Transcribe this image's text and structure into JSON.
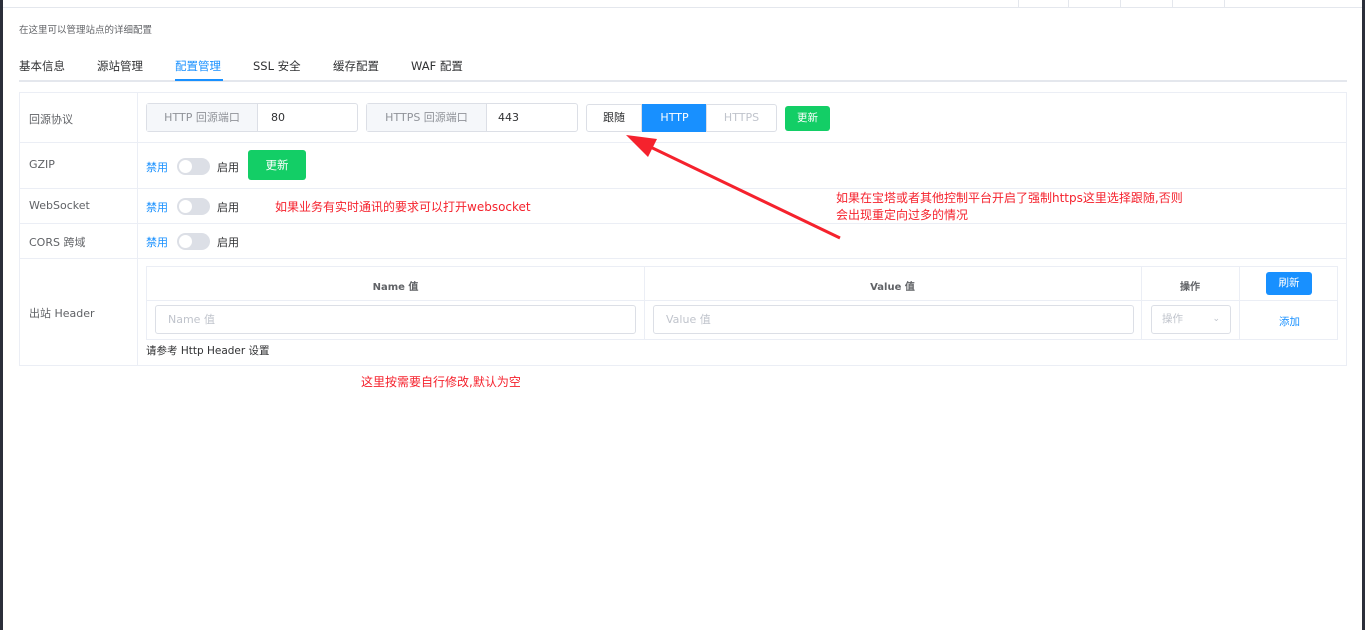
{
  "page": {
    "subtitle": "在这里可以管理站点的详细配置"
  },
  "tabs": [
    {
      "label": "基本信息"
    },
    {
      "label": "源站管理"
    },
    {
      "label": "配置管理"
    },
    {
      "label": "SSL 安全"
    },
    {
      "label": "缓存配置"
    },
    {
      "label": "WAF 配置"
    }
  ],
  "active_tab": "配置管理",
  "rows": {
    "protocol": {
      "label": "回源协议",
      "http_port_prefix": "HTTP 回源端口",
      "http_port_value": "80",
      "https_port_prefix": "HTTPS 回源端口",
      "https_port_value": "443",
      "options": [
        "跟随",
        "HTTP",
        "HTTPS"
      ],
      "selected": "HTTP",
      "update_label": "更新"
    },
    "gzip": {
      "label": "GZIP",
      "off_label": "禁用",
      "on_label": "启用",
      "update_label": "更新"
    },
    "websocket": {
      "label": "WebSocket",
      "off_label": "禁用",
      "on_label": "启用"
    },
    "cors": {
      "label": "CORS 跨域",
      "off_label": "禁用",
      "on_label": "启用"
    },
    "header": {
      "label": "出站 Header",
      "col_name": "Name 值",
      "col_value": "Value 值",
      "col_op": "操作",
      "refresh_label": "刷新",
      "name_placeholder": "Name 值",
      "value_placeholder": "Value 值",
      "op_placeholder": "操作",
      "add_label": "添加",
      "hint": "请参考 Http Header 设置"
    }
  },
  "annotations": {
    "websocket_note": "如果业务有实时通讯的要求可以打开websocket",
    "follow_note_line1": "如果在宝塔或者其他控制平台开启了强制https这里选择跟随,否则",
    "follow_note_line2": "会出现重定向过多的情况",
    "header_note": "这里按需要自行修改,默认为空"
  },
  "colors": {
    "accent": "#1890ff",
    "success": "#13ce66",
    "annotation": "#f5222d"
  }
}
